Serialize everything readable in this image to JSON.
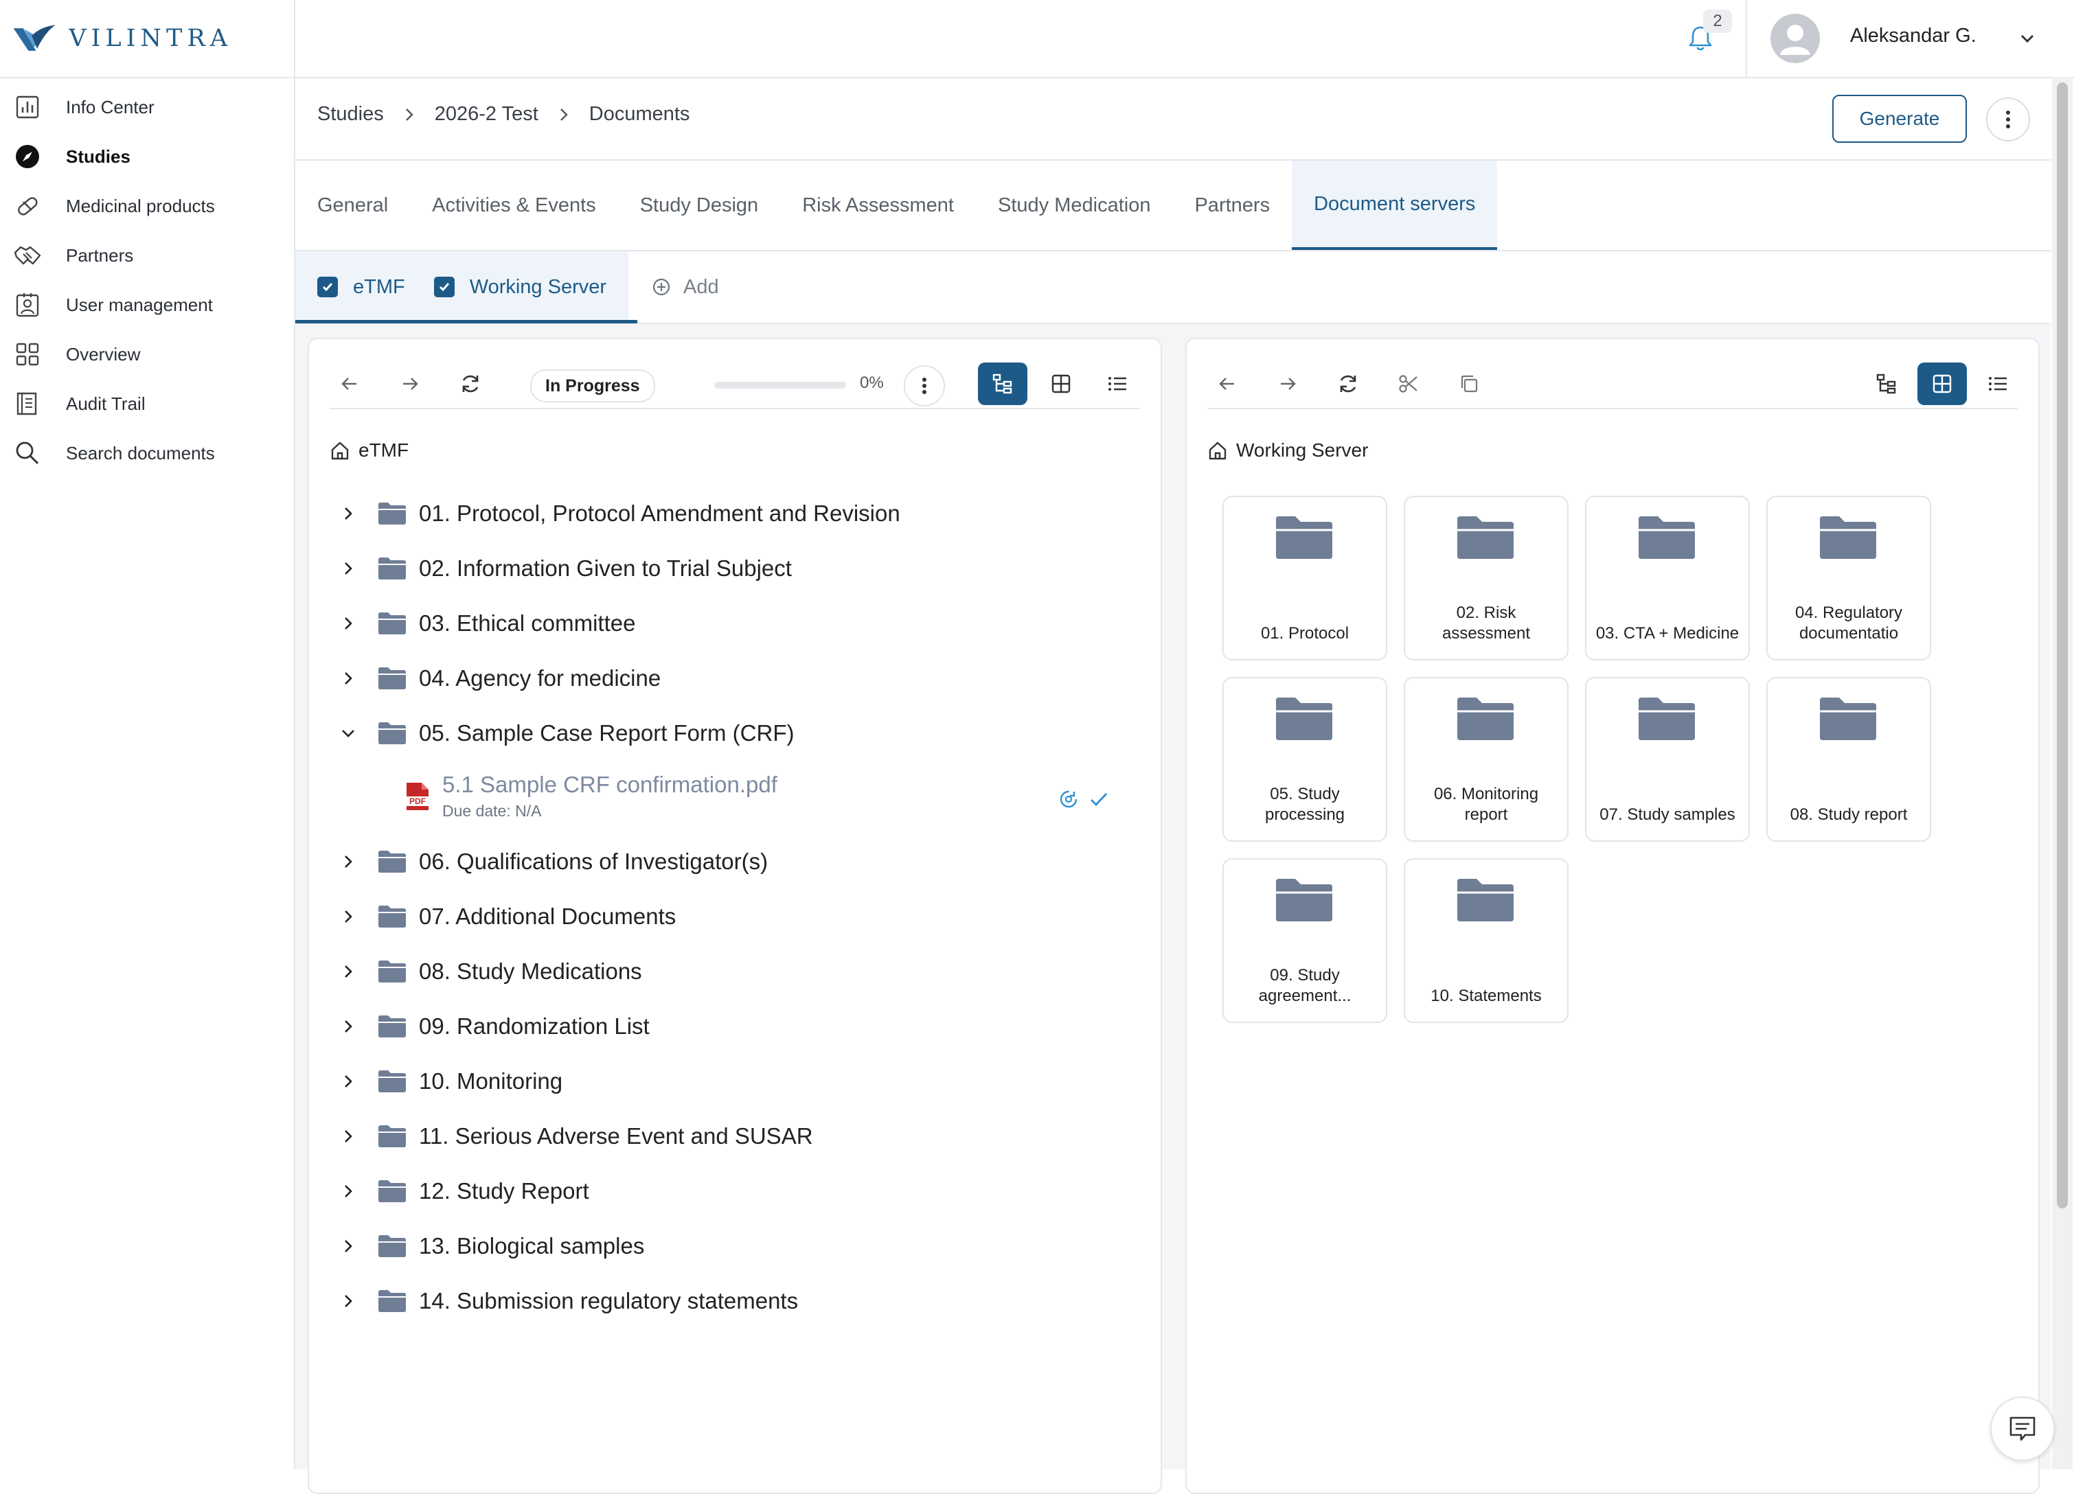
{
  "app": {
    "logo_text": "VILINTRA"
  },
  "sidebar": {
    "items": [
      {
        "label": "Info Center",
        "icon": "chart-icon"
      },
      {
        "label": "Studies",
        "icon": "compass-icon",
        "active": true
      },
      {
        "label": "Medicinal products",
        "icon": "pill-icon"
      },
      {
        "label": "Partners",
        "icon": "handshake-icon"
      },
      {
        "label": "User management",
        "icon": "user-badge-icon"
      },
      {
        "label": "Overview",
        "icon": "grid-icon"
      },
      {
        "label": "Audit Trail",
        "icon": "book-icon"
      },
      {
        "label": "Search documents",
        "icon": "search-icon"
      }
    ]
  },
  "topbar": {
    "notification_count": "2",
    "user_name": "Aleksandar G."
  },
  "breadcrumb": [
    "Studies",
    "2026-2 Test",
    "Documents"
  ],
  "header": {
    "generate_label": "Generate"
  },
  "tabs": [
    "General",
    "Activities & Events",
    "Study Design",
    "Risk Assessment",
    "Study Medication",
    "Partners",
    "Document servers"
  ],
  "active_tab": "Document servers",
  "subtabs": [
    {
      "label": "eTMF",
      "checked": true
    },
    {
      "label": "Working Server",
      "checked": true
    }
  ],
  "add_label": "Add",
  "left_panel": {
    "status": "In Progress",
    "progress_text": "0%",
    "progress_value": 0,
    "root": "eTMF",
    "folders": [
      "01. Protocol, Protocol Amendment and Revision",
      "02. Information Given to Trial Subject",
      "03. Ethical committee",
      "04. Agency for medicine",
      "05. Sample Case Report Form (CRF)",
      "06. Qualifications of Investigator(s)",
      "07. Additional Documents",
      "08. Study Medications",
      "09. Randomization List",
      "10. Monitoring",
      "11. Serious Adverse Event and SUSAR",
      "12. Study Report",
      "13. Biological samples",
      "14. Submission regulatory statements"
    ],
    "expanded_index": 4,
    "file": {
      "name": "5.1 Sample CRF confirmation.pdf",
      "due": "Due date: N/A",
      "badge": "PDF"
    }
  },
  "right_panel": {
    "root": "Working Server",
    "folders": [
      "01. Protocol",
      "02. Risk assessment",
      "03. CTA + Medicine",
      "04. Regulatory documentatio",
      "05. Study processing",
      "06. Monitoring report",
      "07. Study samples",
      "08. Study report",
      "09. Study agreement...",
      "10. Statements"
    ]
  },
  "colors": {
    "accent": "#1d5a87",
    "folder": "#6f7e95",
    "pdf": "#c62828"
  }
}
